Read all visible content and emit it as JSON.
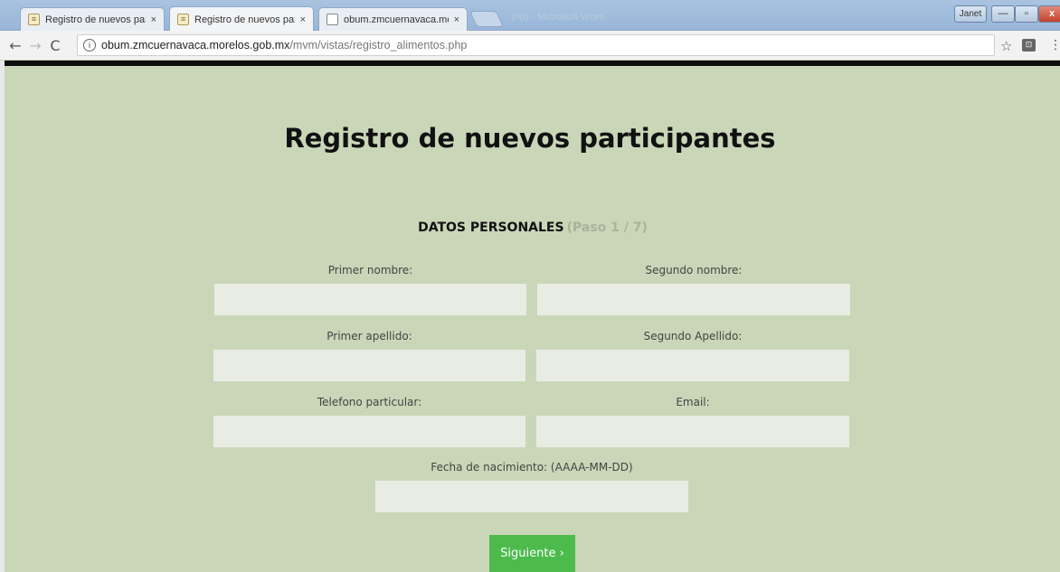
{
  "browser": {
    "tabs": [
      {
        "label": "Registro de nuevos partic",
        "active": false
      },
      {
        "label": "Registro de nuevos partic",
        "active": true
      },
      {
        "label": "obum.zmcuernavaca.mo",
        "active": false
      }
    ],
    "close_glyph": "×",
    "ghost_title": "(no) - Microsoft Word",
    "window_user": "Janet",
    "url_host": "obum.zmcuernavaca.morelos.gob.mx",
    "url_path": "/mvm/vistas/registro_alimentos.php"
  },
  "page": {
    "title": "Registro de nuevos participantes",
    "step_title": "DATOS PERSONALES",
    "step_progress": "(Paso 1 / 7)",
    "fields": {
      "primer_nombre": "Primer nombre:",
      "segundo_nombre": "Segundo nombre:",
      "primer_apellido": "Primer apellido:",
      "segundo_apellido": "Segundo Apellido:",
      "telefono": "Telefono particular:",
      "email": "Email:",
      "fecha": "Fecha de nacimiento: (AAAA-MM-DD)"
    },
    "next_button": "Siguiente ›"
  },
  "colors": {
    "page_bg": "#c9d6b8",
    "field_bg": "#e8ece3",
    "button_bg": "#4cbb4c"
  }
}
